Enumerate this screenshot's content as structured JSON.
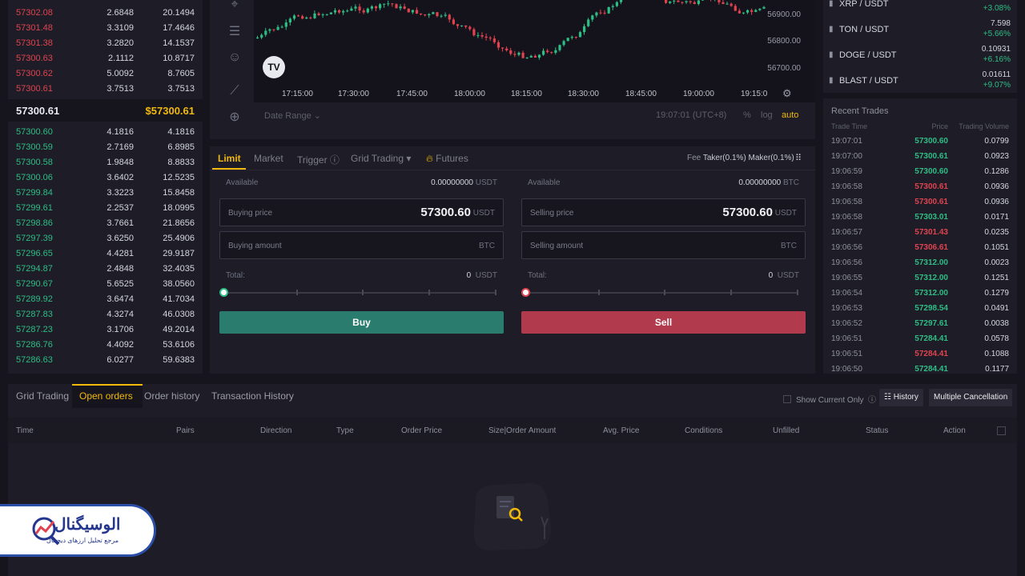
{
  "orderbook": {
    "asks": [
      {
        "price": "57302.08",
        "amount": "2.6848",
        "total": "20.1494"
      },
      {
        "price": "57301.48",
        "amount": "3.3109",
        "total": "17.4646"
      },
      {
        "price": "57301.38",
        "amount": "3.2820",
        "total": "14.1537"
      },
      {
        "price": "57300.63",
        "amount": "2.1112",
        "total": "10.8717"
      },
      {
        "price": "57300.62",
        "amount": "5.0092",
        "total": "8.7605"
      },
      {
        "price": "57300.61",
        "amount": "3.7513",
        "total": "3.7513"
      }
    ],
    "mid_price": "57300.61",
    "mid_usd": "$57300.61",
    "bids": [
      {
        "price": "57300.60",
        "amount": "4.1816",
        "total": "4.1816"
      },
      {
        "price": "57300.59",
        "amount": "2.7169",
        "total": "6.8985"
      },
      {
        "price": "57300.58",
        "amount": "1.9848",
        "total": "8.8833"
      },
      {
        "price": "57300.06",
        "amount": "3.6402",
        "total": "12.5235"
      },
      {
        "price": "57299.84",
        "amount": "3.3223",
        "total": "15.8458"
      },
      {
        "price": "57299.61",
        "amount": "2.2537",
        "total": "18.0995"
      },
      {
        "price": "57298.86",
        "amount": "3.7661",
        "total": "21.8656"
      },
      {
        "price": "57297.39",
        "amount": "3.6250",
        "total": "25.4906"
      },
      {
        "price": "57296.65",
        "amount": "4.4281",
        "total": "29.9187"
      },
      {
        "price": "57294.87",
        "amount": "2.4848",
        "total": "32.4035"
      },
      {
        "price": "57290.67",
        "amount": "5.6525",
        "total": "38.0560"
      },
      {
        "price": "57289.92",
        "amount": "3.6474",
        "total": "41.7034"
      },
      {
        "price": "57287.83",
        "amount": "4.3274",
        "total": "46.0308"
      },
      {
        "price": "57287.23",
        "amount": "3.1706",
        "total": "49.2014"
      },
      {
        "price": "57286.76",
        "amount": "4.4092",
        "total": "53.6106"
      },
      {
        "price": "57286.63",
        "amount": "6.0277",
        "total": "59.6383"
      }
    ]
  },
  "chart": {
    "price_labels": [
      "56900.00",
      "56800.00",
      "56700.00"
    ],
    "time_labels": [
      "17:15:00",
      "17:30:00",
      "17:45:00",
      "18:00:00",
      "18:15:00",
      "18:30:00",
      "18:45:00",
      "19:00:00",
      "19:15:0"
    ],
    "logo_text": "TV",
    "date_range": "Date Range",
    "clock": "19:07:01 (UTC+8)",
    "pct": "%",
    "log": "log",
    "auto": "auto"
  },
  "trade": {
    "tabs": {
      "limit": "Limit",
      "market": "Market",
      "trigger": "Trigger",
      "grid": "Grid Trading",
      "futures": "Futures"
    },
    "fee_label": "Fee",
    "fee_value": "Taker(0.1%) Maker(0.1%)",
    "buy": {
      "available_label": "Available",
      "available_value": "0.00000000",
      "available_unit": "USDT",
      "price_label": "Buying price",
      "price_value": "57300.60",
      "price_unit": "USDT",
      "amount_label": "Buying amount",
      "amount_unit": "BTC",
      "total_label": "Total:",
      "total_value": "0",
      "total_unit": "USDT",
      "button": "Buy",
      "slider_fraction": 0
    },
    "sell": {
      "available_label": "Available",
      "available_value": "0.00000000",
      "available_unit": "BTC",
      "price_label": "Selling price",
      "price_value": "57300.60",
      "price_unit": "USDT",
      "amount_label": "Selling amount",
      "amount_unit": "BTC",
      "total_label": "Total:",
      "total_value": "0",
      "total_unit": "USDT",
      "button": "Sell",
      "slider_fraction": 0
    }
  },
  "markets": [
    {
      "pair": "XRP / USDT",
      "price": "",
      "change": "+3.08%"
    },
    {
      "pair": "TON / USDT",
      "price": "7.598",
      "change": "+5.66%"
    },
    {
      "pair": "DOGE / USDT",
      "price": "0.10931",
      "change": "+6.16%"
    },
    {
      "pair": "BLAST / USDT",
      "price": "0.01611",
      "change": "+9.07%"
    }
  ],
  "recent_trades": {
    "title": "Recent Trades",
    "headers": {
      "time": "Trade Time",
      "price": "Price",
      "volume": "Trading Volume"
    },
    "rows": [
      {
        "time": "19:07:01",
        "price": "57300.60",
        "volume": "0.0799",
        "side": "buy"
      },
      {
        "time": "19:07:00",
        "price": "57300.61",
        "volume": "0.0923",
        "side": "buy"
      },
      {
        "time": "19:06:59",
        "price": "57300.60",
        "volume": "0.1286",
        "side": "buy"
      },
      {
        "time": "19:06:58",
        "price": "57300.61",
        "volume": "0.0936",
        "side": "sell"
      },
      {
        "time": "19:06:58",
        "price": "57300.61",
        "volume": "0.0936",
        "side": "sell"
      },
      {
        "time": "19:06:58",
        "price": "57303.01",
        "volume": "0.0171",
        "side": "buy"
      },
      {
        "time": "19:06:57",
        "price": "57301.43",
        "volume": "0.0235",
        "side": "sell"
      },
      {
        "time": "19:06:56",
        "price": "57306.61",
        "volume": "0.1051",
        "side": "sell"
      },
      {
        "time": "19:06:56",
        "price": "57312.00",
        "volume": "0.0023",
        "side": "buy"
      },
      {
        "time": "19:06:55",
        "price": "57312.00",
        "volume": "0.1251",
        "side": "buy"
      },
      {
        "time": "19:06:54",
        "price": "57312.00",
        "volume": "0.1279",
        "side": "buy"
      },
      {
        "time": "19:06:53",
        "price": "57298.54",
        "volume": "0.0491",
        "side": "buy"
      },
      {
        "time": "19:06:52",
        "price": "57297.61",
        "volume": "0.0038",
        "side": "buy"
      },
      {
        "time": "19:06:51",
        "price": "57284.41",
        "volume": "0.0578",
        "side": "buy"
      },
      {
        "time": "19:06:51",
        "price": "57284.41",
        "volume": "0.1088",
        "side": "sell"
      },
      {
        "time": "19:06:50",
        "price": "57284.41",
        "volume": "0.1177",
        "side": "buy"
      }
    ]
  },
  "orders": {
    "tabs": {
      "grid": "Grid Trading",
      "open": "Open orders",
      "history": "Order history",
      "transactions": "Transaction History"
    },
    "show_current": "Show Current Only",
    "history_btn": "History",
    "cancel_btn": "Multiple Cancellation",
    "columns": [
      "Time",
      "Pairs",
      "Direction",
      "Type",
      "Order Price",
      "Size|Order Amount",
      "Avg. Price",
      "Conditions",
      "Unfilled",
      "Status",
      "Action"
    ]
  },
  "logo": {
    "name": "الوسیگنال",
    "subtitle": "مرجع تحلیل ارزهای دیجیتال"
  },
  "colors": {
    "up": "#2ebd85",
    "down": "#e0434f",
    "accent": "#f0b90b",
    "buy_button": "#2a7d6e",
    "sell_button": "#b13a4c"
  },
  "icons": [
    "crosshair-icon",
    "lines-icon",
    "emoji-icon",
    "ruler-icon",
    "zoom-icon",
    "settings-icon",
    "star-icon",
    "grid-icon",
    "info-icon",
    "fire-icon",
    "search-document-icon"
  ]
}
